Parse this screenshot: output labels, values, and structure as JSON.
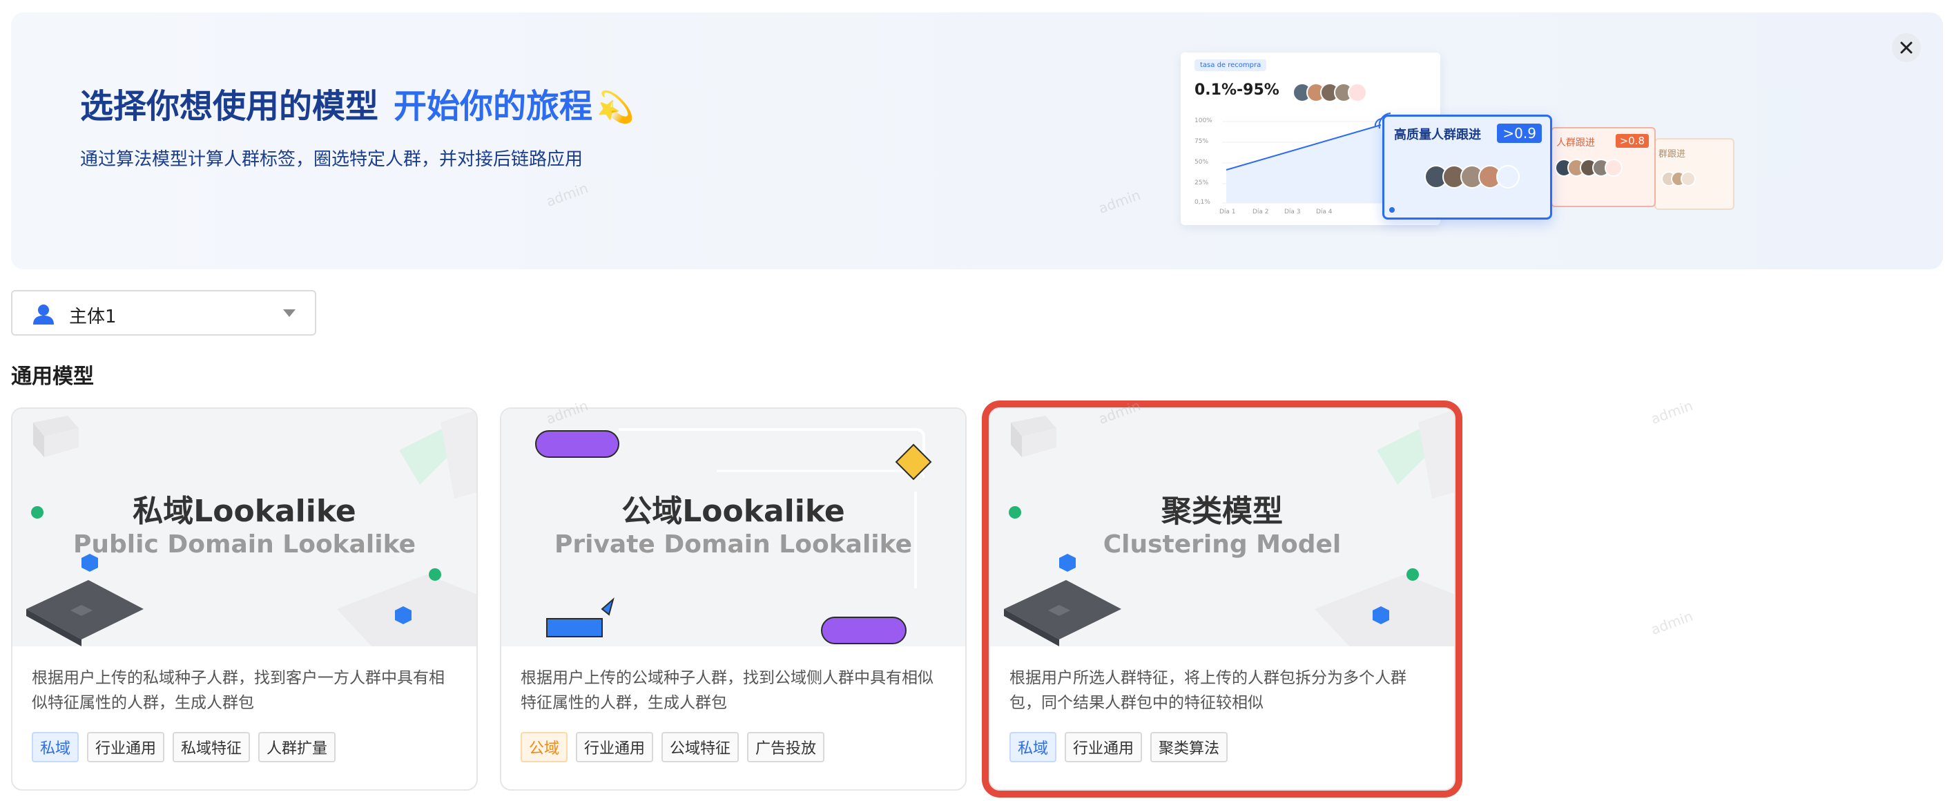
{
  "banner": {
    "title_main": "选择你想使用的模型",
    "title_accent": "开始你的旅程",
    "title_emoji": "💫",
    "subtitle": "通过算法模型计算人群标签，圈选特定人群，并对接后链路应用",
    "close_icon": "close-icon",
    "illustration": {
      "chip": "tasa de recompra",
      "rate": "0.1%-95%",
      "y_ticks": [
        "100%",
        "75%",
        "50%",
        "25%",
        "0,1%"
      ],
      "x_ticks": [
        "Día 1",
        "Día 2",
        "Día 3",
        "Día 4"
      ],
      "card_primary_title": "高质量人群跟进",
      "card_primary_badge": ">0.9",
      "card_secondary_title": "人群跟进",
      "card_secondary_badge": ">0.8",
      "card_tertiary_title": "群跟进"
    }
  },
  "subject_select": {
    "icon": "user-icon",
    "value": "主体1",
    "caret_icon": "caret-down-icon"
  },
  "section": {
    "title": "通用模型"
  },
  "cards": [
    {
      "title": "私域Lookalike",
      "subtitle_en": "Public Domain Lookalike",
      "description": "根据用户上传的私域种子人群，找到客户一方人群中具有相似特征属性的人群，生成人群包",
      "tags": [
        "私域",
        "行业通用",
        "私域特征",
        "人群扩量"
      ],
      "selected": false
    },
    {
      "title": "公域Lookalike",
      "subtitle_en": "Private Domain Lookalike",
      "description": "根据用户上传的公域种子人群，找到公域侧人群中具有相似特征属性的人群，生成人群包",
      "tags": [
        "公域",
        "行业通用",
        "公域特征",
        "广告投放"
      ],
      "selected": false
    },
    {
      "title": "聚类模型",
      "subtitle_en": "Clustering Model",
      "description": "根据用户所选人群特征，将上传的人群包拆分为多个人群包，同个结果人群包中的特征较相似",
      "tags": [
        "私域",
        "行业通用",
        "聚类算法"
      ],
      "selected": true
    }
  ],
  "watermark": "admin",
  "colors": {
    "accent_blue": "#2b6cf0",
    "title_navy": "#1a3d8f",
    "selected_outline": "#e44a3c",
    "tag_orange": "#f08a14"
  }
}
